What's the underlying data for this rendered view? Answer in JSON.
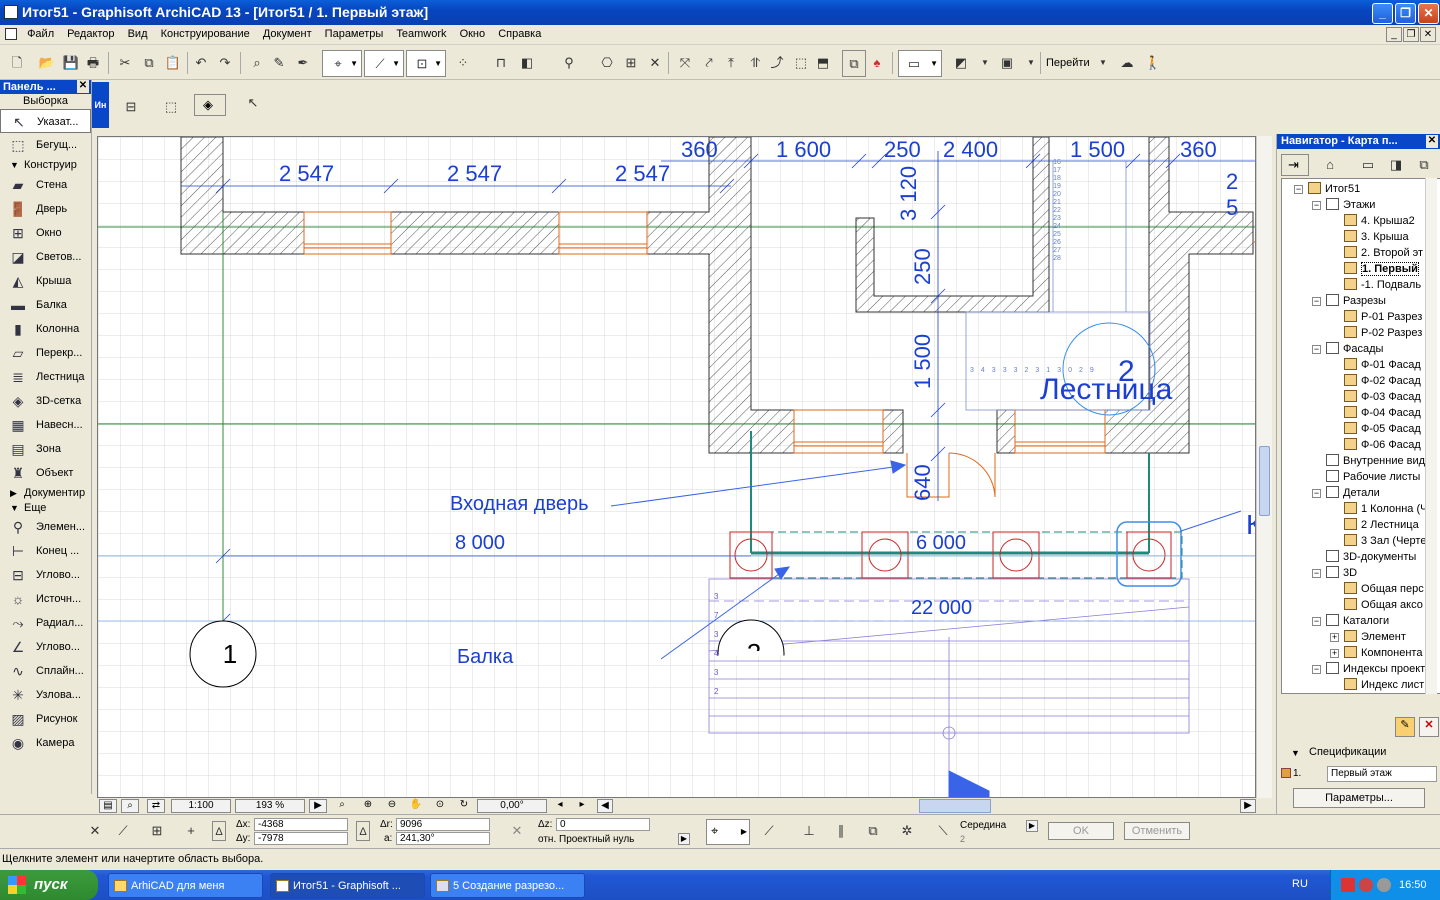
{
  "window": {
    "title": "Итог51 - Graphisoft ArchiCAD 13 - [Итог51 / 1. Первый этаж]",
    "minimize": "_",
    "maximize": "❐",
    "close": "✕"
  },
  "menu": [
    "Файл",
    "Редактор",
    "Вид",
    "Конструирование",
    "Документ",
    "Параметры",
    "Teamwork",
    "Окно",
    "Справка"
  ],
  "toolbar": {
    "goto_label": "Перейти"
  },
  "toolbox": {
    "title": "Панель ...",
    "close": "✕",
    "selection_title": "Выборка",
    "pointer": "Указат...",
    "marquee": "Бегущ...",
    "section_construct": "Конструир",
    "construct_items": [
      "Стена",
      "Дверь",
      "Окно",
      "Светов...",
      "Крыша",
      "Балка",
      "Колонна",
      "Перекр...",
      "Лестница",
      "3D-сетка",
      "Навесн...",
      "Зона",
      "Объект"
    ],
    "section_document": "Документир",
    "section_more": "Еще",
    "more_items": [
      "Элемен...",
      "Конец ...",
      "Углово...",
      "Источн...",
      "Радиал...",
      "Углово...",
      "Сплайн...",
      "Узлова...",
      "Рисунок",
      "Камера"
    ]
  },
  "infobox": {
    "tab": "Ин"
  },
  "drawing": {
    "dims_top": [
      "360",
      "1 600",
      "250",
      "2 400",
      "1 500",
      "360",
      "2 5"
    ],
    "dims_row2": [
      "2 547",
      "2 547",
      "2 547"
    ],
    "dims_vertical": [
      "3 120",
      "250",
      "1 500",
      "640"
    ],
    "stair_numbers_right": [
      "16",
      "17",
      "18",
      "19",
      "20",
      "21",
      "22",
      "23",
      "24",
      "25",
      "26",
      "27",
      "28"
    ],
    "stair_numbers_left": [
      "34",
      "33",
      "32",
      "31",
      "30",
      "29"
    ],
    "label_entrance": "Входная дверь",
    "label_beam": "Балка",
    "label_stair": "Лестница",
    "stair_marker": "2",
    "axis_marker_1": "1",
    "axis_marker_2": "2",
    "dim_8000": "8  000",
    "dim_6000": "6  000",
    "dim_22000": "22  000",
    "label_k": "К",
    "row_numbers": [
      "3",
      "7",
      "3",
      "4",
      "3",
      "2"
    ]
  },
  "view_controls": {
    "scale": "1:100",
    "zoom": "193 %",
    "angle": "0,00°"
  },
  "navigator": {
    "title": "Навигатор - Карта п...",
    "close": "✕",
    "tree": [
      {
        "label": "Итог51",
        "level": 0,
        "pm": "−"
      },
      {
        "label": "Этажи",
        "level": 1,
        "pm": "−"
      },
      {
        "label": "4. Крыша2",
        "level": 2
      },
      {
        "label": "3. Крыша",
        "level": 2
      },
      {
        "label": "2. Второй эт",
        "level": 2
      },
      {
        "label": "1. Первый",
        "level": 2,
        "selected": true
      },
      {
        "label": "-1. Подваль",
        "level": 2
      },
      {
        "label": "Разрезы",
        "level": 1,
        "pm": "−"
      },
      {
        "label": "Р-01 Разрез",
        "level": 2
      },
      {
        "label": "Р-02 Разрез",
        "level": 2
      },
      {
        "label": "Фасады",
        "level": 1,
        "pm": "−"
      },
      {
        "label": "Ф-01 Фасад",
        "level": 2
      },
      {
        "label": "Ф-02 Фасад",
        "level": 2
      },
      {
        "label": "Ф-03 Фасад",
        "level": 2
      },
      {
        "label": "Ф-04 Фасад",
        "level": 2
      },
      {
        "label": "Ф-05 Фасад",
        "level": 2
      },
      {
        "label": "Ф-06 Фасад",
        "level": 2
      },
      {
        "label": "Внутренние вид",
        "level": 1
      },
      {
        "label": "Рабочие листы",
        "level": 1
      },
      {
        "label": "Детали",
        "level": 1,
        "pm": "−"
      },
      {
        "label": "1 Колонна (Ч",
        "level": 2
      },
      {
        "label": "2 Лестница",
        "level": 2
      },
      {
        "label": "3 Зал (Черте",
        "level": 2
      },
      {
        "label": "3D-документы",
        "level": 1
      },
      {
        "label": "3D",
        "level": 1,
        "pm": "−"
      },
      {
        "label": "Общая перс",
        "level": 2
      },
      {
        "label": "Общая аксо",
        "level": 2
      },
      {
        "label": "Каталоги",
        "level": 1,
        "pm": "−"
      },
      {
        "label": "Элемент",
        "level": 2,
        "pm": "+"
      },
      {
        "label": "Компонента",
        "level": 2,
        "pm": "+"
      },
      {
        "label": "Индексы проект",
        "level": 1,
        "pm": "−"
      },
      {
        "label": "Индекс лист",
        "level": 2
      }
    ],
    "specs_label": "Спецификации",
    "spec_num": "1.",
    "spec_value": "Первый этаж",
    "params_button": "Параметры..."
  },
  "coords": {
    "dx_label": "Δx:",
    "dx_value": "-4368",
    "dy_label": "Δy:",
    "dy_value": "-7978",
    "dr_label": "Δr:",
    "dr_value": "9096",
    "a_label": "a:",
    "a_value": "241,30°",
    "dz_label": "Δz:",
    "dz_value": "0",
    "ref_label": "отн. Проектный нуль",
    "snap_label": "Середина",
    "snap_value": "2",
    "ok": "OK",
    "cancel": "Отменить"
  },
  "status": "Щелкните элемент или начертите область выбора.",
  "taskbar": {
    "start": "пуск",
    "tasks": [
      "ArhiCAD для меня",
      "Итог51 - Graphisoft ...",
      "5 Создание разрезо..."
    ],
    "lang": "RU",
    "time": "16:50"
  },
  "colors": {
    "dim_blue": "#1a3fd1",
    "wall_hatch": "#555555",
    "grid_green": "#2e8b3c",
    "window_orange": "#e06a1a",
    "beam_teal": "#1f8a7a",
    "column_red": "#cc2222",
    "annot_blue": "#3a64e8"
  }
}
